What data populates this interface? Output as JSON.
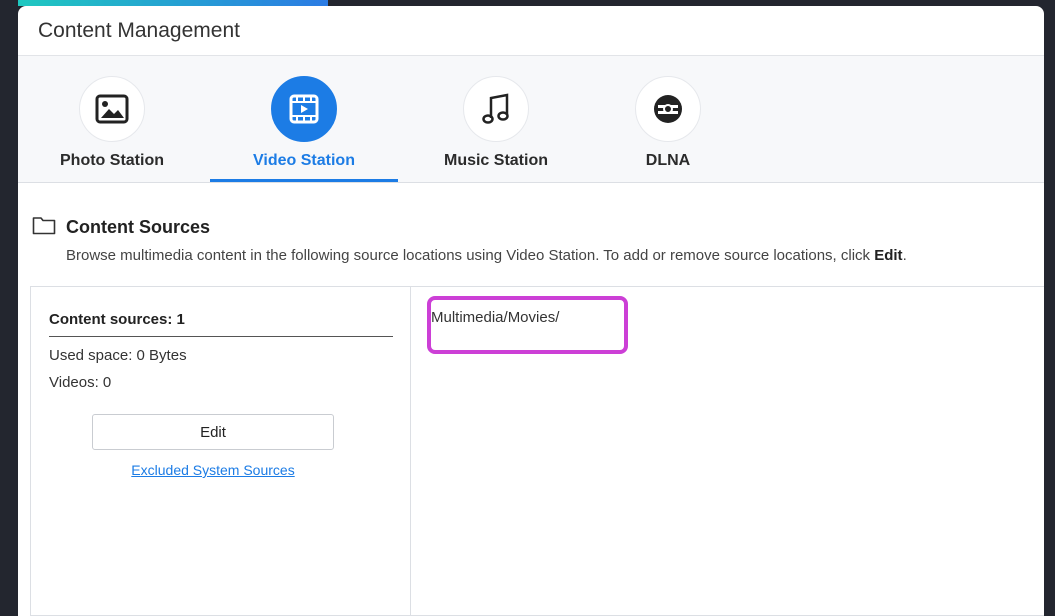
{
  "window": {
    "title": "Content Management"
  },
  "tabs": [
    {
      "label": "Photo Station",
      "icon": "photo-icon",
      "active": false
    },
    {
      "label": "Video Station",
      "icon": "video-icon",
      "active": true
    },
    {
      "label": "Music Station",
      "icon": "music-note-icon",
      "active": false
    },
    {
      "label": "DLNA",
      "icon": "dlna-icon",
      "active": false
    }
  ],
  "section": {
    "title": "Content Sources",
    "description": "Browse multimedia content in the following source locations using Video Station. To add or remove source locations, click ",
    "description_bold": "Edit",
    "description_end": "."
  },
  "sources": {
    "count_label": "Content sources: 1",
    "used_space": "Used space:  0 Bytes",
    "videos": "Videos:  0",
    "edit_label": "Edit",
    "excluded_link": "Excluded System Sources",
    "paths": [
      "Multimedia/Movies/"
    ]
  },
  "colors": {
    "accent": "#1c7ce5",
    "highlight": "#cc3fd6",
    "background": "#23262f"
  }
}
